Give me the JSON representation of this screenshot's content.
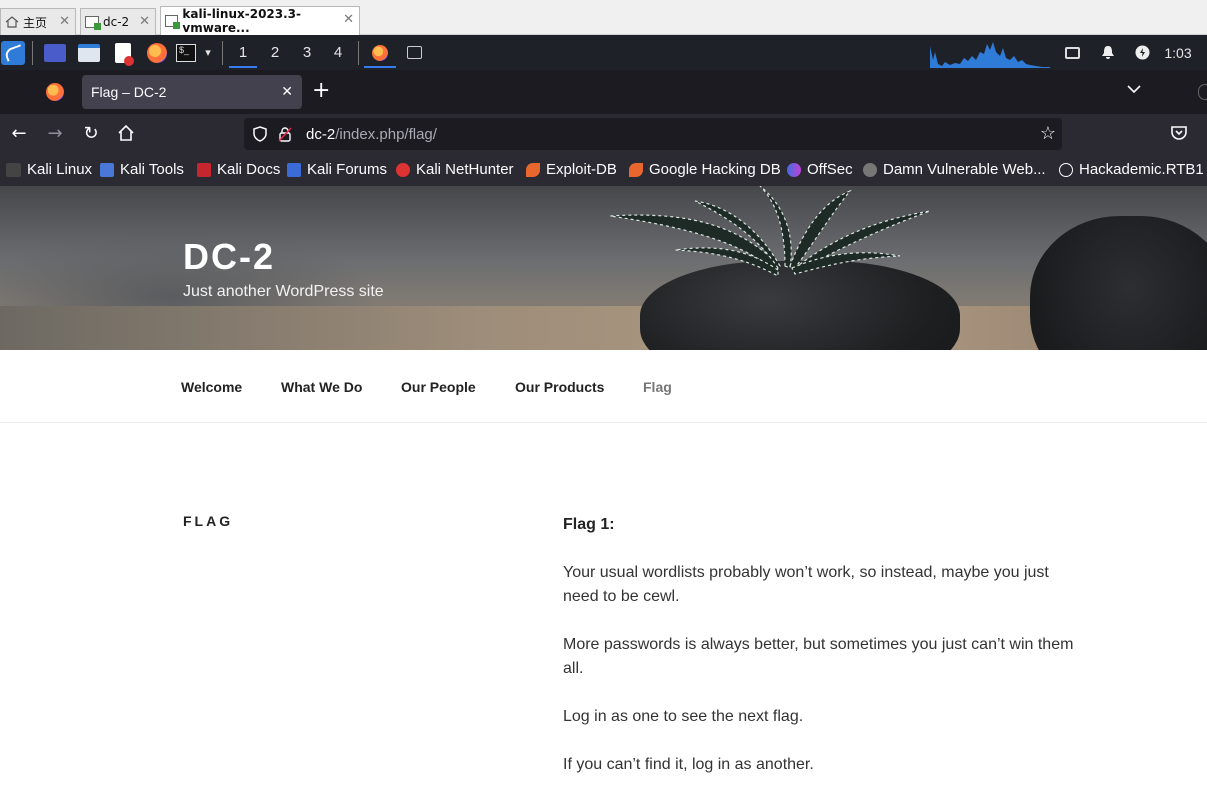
{
  "host_tabs": [
    {
      "label": "主页"
    },
    {
      "label": "dc-2"
    },
    {
      "label": "kali-linux-2023.3-vmware..."
    }
  ],
  "panel": {
    "workspaces": [
      "1",
      "2",
      "3",
      "4"
    ],
    "clock": "1:03",
    "accent_color": "#367bf0"
  },
  "browser": {
    "tab_title": "Flag – DC-2",
    "url_host": "dc-2",
    "url_path": "/index.php/flag/",
    "bookmarks": [
      "Kali Linux",
      "Kali Tools",
      "Kali Docs",
      "Kali Forums",
      "Kali NetHunter",
      "Exploit-DB",
      "Google Hacking DB",
      "OffSec",
      "Damn Vulnerable Web...",
      "Hackademic.RTB1"
    ],
    "bookmarks_overflow": "»"
  },
  "site": {
    "title": "DC-2",
    "tagline": "Just another WordPress site",
    "menu": [
      "Welcome",
      "What We Do",
      "Our People",
      "Our Products",
      "Flag"
    ]
  },
  "page": {
    "heading": "FLAG",
    "flag_label": "Flag 1:",
    "paragraphs": [
      "Your usual wordlists probably won’t work, so instead, maybe you just need to be cewl.",
      "More passwords is always better, but sometimes you just can’t win them all.",
      "Log in as one to see the next flag.",
      "If you can’t find it, log in as another."
    ]
  }
}
